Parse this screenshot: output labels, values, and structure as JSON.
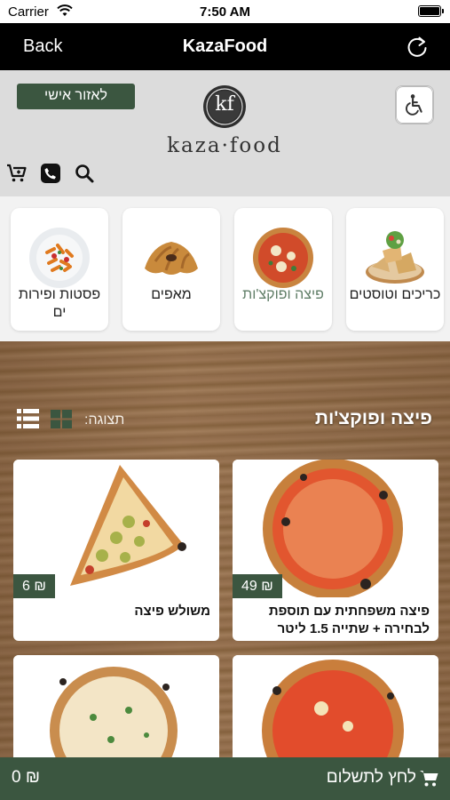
{
  "status_bar": {
    "carrier": "Carrier",
    "time": "7:50 AM"
  },
  "nav": {
    "back_label": "Back",
    "title": "KazaFood"
  },
  "header": {
    "personal_area_label": "לאזור אישי",
    "logo_monogram": "kf",
    "logo_text": "kaza·food",
    "icons": [
      "cart-icon",
      "phone-icon",
      "search-icon",
      "accessibility-icon",
      "refresh-icon"
    ]
  },
  "categories": [
    {
      "label": "כריכים וטוסטים",
      "icon": "sandwich-image"
    },
    {
      "label": "פיצה ופוקצ'ות",
      "icon": "pizza-image",
      "active": true
    },
    {
      "label": "מאפים",
      "icon": "croissant-image"
    },
    {
      "label": "פסטות ופירות ים",
      "icon": "pasta-image"
    }
  ],
  "products_section": {
    "title": "פיצה ופוקצ'ות",
    "display_label": "תצוגה:",
    "items": [
      {
        "name": "פיצה משפחתית עם תוספת לבחירה + שתייה 1.5 ליטר",
        "price": "49 ₪"
      },
      {
        "name": "משולש פיצה",
        "price": "6 ₪"
      },
      {
        "name": "",
        "price": ""
      },
      {
        "name": "",
        "price": ""
      }
    ]
  },
  "checkout": {
    "label": "לחץ לתשלום",
    "total": "0 ₪"
  },
  "colors": {
    "brand_green": "#3b5640",
    "header_bg": "#dcdcdc",
    "nav_bg": "#000000"
  }
}
